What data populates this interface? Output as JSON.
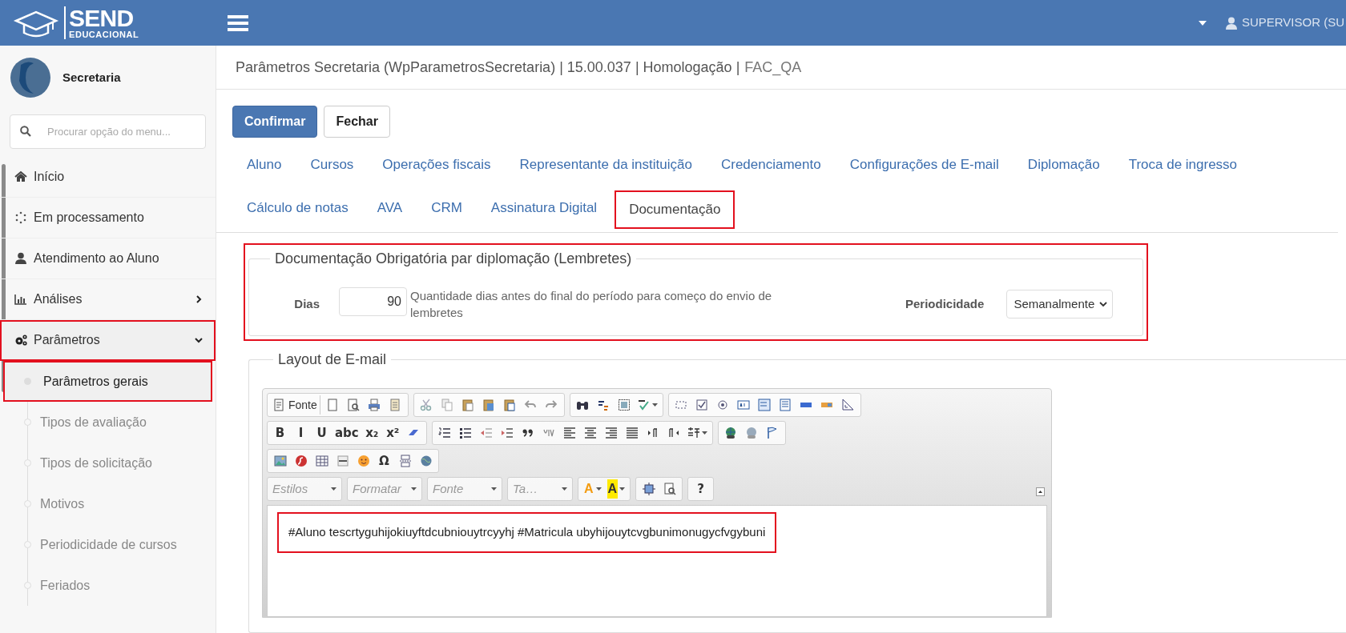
{
  "header": {
    "logo_top": "SEND",
    "logo_bottom": "EDUCACIONAL",
    "user": "SUPERVISOR (SU"
  },
  "sidebar": {
    "module": "Secretaria",
    "search": {
      "placeholder": "Procurar opção do menu..."
    },
    "items": [
      {
        "label": "Início",
        "kind": "link",
        "annotated": false
      },
      {
        "label": "Em processamento",
        "kind": "link",
        "annotated": false
      },
      {
        "label": "Atendimento ao Aluno",
        "kind": "link",
        "annotated": false
      },
      {
        "label": "Análises",
        "kind": "group",
        "expanded": false,
        "annotated": false
      },
      {
        "label": "Parâmetros",
        "kind": "group",
        "expanded": true,
        "annotated": true,
        "children": [
          {
            "label": "Parâmetros gerais",
            "selected": true,
            "annotated": true
          },
          {
            "label": "Tipos de avaliação",
            "selected": false,
            "annotated": false
          },
          {
            "label": "Tipos de solicitação",
            "selected": false,
            "annotated": false
          },
          {
            "label": "Motivos",
            "selected": false,
            "annotated": false
          },
          {
            "label": "Periodicidade de cursos",
            "selected": false,
            "annotated": false
          },
          {
            "label": "Feriados",
            "selected": false,
            "annotated": false
          }
        ]
      }
    ]
  },
  "page": {
    "title": "Parâmetros Secretaria (WpParametrosSecretaria) | 15.00.037 | Homologação |",
    "environment": "FAC_QA",
    "buttons": [
      {
        "label": "Confirmar",
        "kind": "primary"
      },
      {
        "label": "Fechar",
        "kind": "default"
      }
    ],
    "tabs": [
      {
        "label": "Aluno",
        "selected": false,
        "annotated": false
      },
      {
        "label": "Cursos",
        "selected": false,
        "annotated": false
      },
      {
        "label": "Operações fiscais",
        "selected": false,
        "annotated": false
      },
      {
        "label": "Representante da instituição",
        "selected": false,
        "annotated": false
      },
      {
        "label": "Credenciamento",
        "selected": false,
        "annotated": false
      },
      {
        "label": "Configurações de E-mail",
        "selected": false,
        "annotated": false
      },
      {
        "label": "Diplomação",
        "selected": false,
        "annotated": false
      },
      {
        "label": "Troca de ingresso",
        "selected": false,
        "annotated": false
      },
      {
        "label": "Cálculo de notas",
        "selected": false,
        "annotated": false
      },
      {
        "label": "AVA",
        "selected": false,
        "annotated": false
      },
      {
        "label": "CRM",
        "selected": false,
        "annotated": false
      },
      {
        "label": "Assinatura Digital",
        "selected": false,
        "annotated": false
      },
      {
        "label": "Documentação",
        "selected": true,
        "annotated": true
      }
    ],
    "reminders": {
      "legend": "Documentação Obrigatória par diplomação (Lembretes)",
      "annotated": true,
      "days_label": "Dias",
      "days_value": "90",
      "days_help": "Quantidade dias antes do final do período para começo do envio de lembretes",
      "periodicity_label": "Periodicidade",
      "periodicity_value": "Semanalmente"
    },
    "layout": {
      "legend": "Layout de E-mail",
      "toolbar_rows": [
        [
          [
            {
              "kind": "text_button",
              "label": "Fonte"
            },
            {
              "kind": "icon"
            },
            {
              "kind": "icon"
            },
            {
              "kind": "icon"
            },
            {
              "kind": "icon"
            }
          ],
          [
            {
              "kind": "icon"
            },
            {
              "kind": "icon"
            },
            {
              "kind": "icon"
            },
            {
              "kind": "icon"
            },
            {
              "kind": "icon"
            },
            {
              "kind": "icon"
            },
            {
              "kind": "icon"
            }
          ],
          [
            {
              "kind": "icon"
            },
            {
              "kind": "icon"
            },
            {
              "kind": "icon"
            },
            {
              "kind": "dropdown"
            }
          ],
          [
            {
              "kind": "icon"
            },
            {
              "kind": "icon"
            },
            {
              "kind": "icon"
            },
            {
              "kind": "icon"
            },
            {
              "kind": "icon"
            },
            {
              "kind": "icon"
            },
            {
              "kind": "icon"
            },
            {
              "kind": "icon"
            },
            {
              "kind": "icon"
            }
          ]
        ],
        [
          [
            {
              "kind": "glyph",
              "text": "B"
            },
            {
              "kind": "glyph",
              "text": "I"
            },
            {
              "kind": "glyph",
              "text": "U"
            },
            {
              "kind": "glyph",
              "text": "abc"
            },
            {
              "kind": "glyph",
              "text": "x₂"
            },
            {
              "kind": "glyph",
              "text": "x²"
            },
            {
              "kind": "icon"
            }
          ],
          [
            {
              "kind": "icon"
            },
            {
              "kind": "icon"
            },
            {
              "kind": "icon"
            },
            {
              "kind": "icon"
            },
            {
              "kind": "icon"
            },
            {
              "kind": "icon"
            },
            {
              "kind": "icon"
            },
            {
              "kind": "icon"
            },
            {
              "kind": "icon"
            },
            {
              "kind": "icon"
            },
            {
              "kind": "icon"
            },
            {
              "kind": "icon"
            },
            {
              "kind": "dropdown"
            }
          ],
          [
            {
              "kind": "icon"
            },
            {
              "kind": "icon"
            },
            {
              "kind": "icon"
            }
          ]
        ],
        [
          [
            {
              "kind": "icon"
            },
            {
              "kind": "icon"
            },
            {
              "kind": "icon"
            },
            {
              "kind": "icon"
            },
            {
              "kind": "icon"
            },
            {
              "kind": "glyph",
              "text": "Ω"
            },
            {
              "kind": "icon"
            },
            {
              "kind": "icon"
            }
          ]
        ],
        [
          [
            {
              "kind": "combo",
              "label": "Estilos"
            }
          ],
          [
            {
              "kind": "combo",
              "label": "Formatar"
            }
          ],
          [
            {
              "kind": "combo",
              "label": "Fonte"
            }
          ],
          [
            {
              "kind": "combo",
              "label": "Ta…"
            }
          ],
          [
            {
              "kind": "color",
              "text": "A"
            },
            {
              "kind": "color",
              "text": "A"
            }
          ],
          [
            {
              "kind": "icon"
            },
            {
              "kind": "icon"
            }
          ],
          [
            {
              "kind": "glyph",
              "text": "?"
            }
          ]
        ]
      ],
      "content": "#Aluno tescrtyguhijokiuyftdcubniouytrcyyhj #Matricula ubyhijouytcvgbunimonugycfvgybuni",
      "content_annotated": true
    }
  }
}
